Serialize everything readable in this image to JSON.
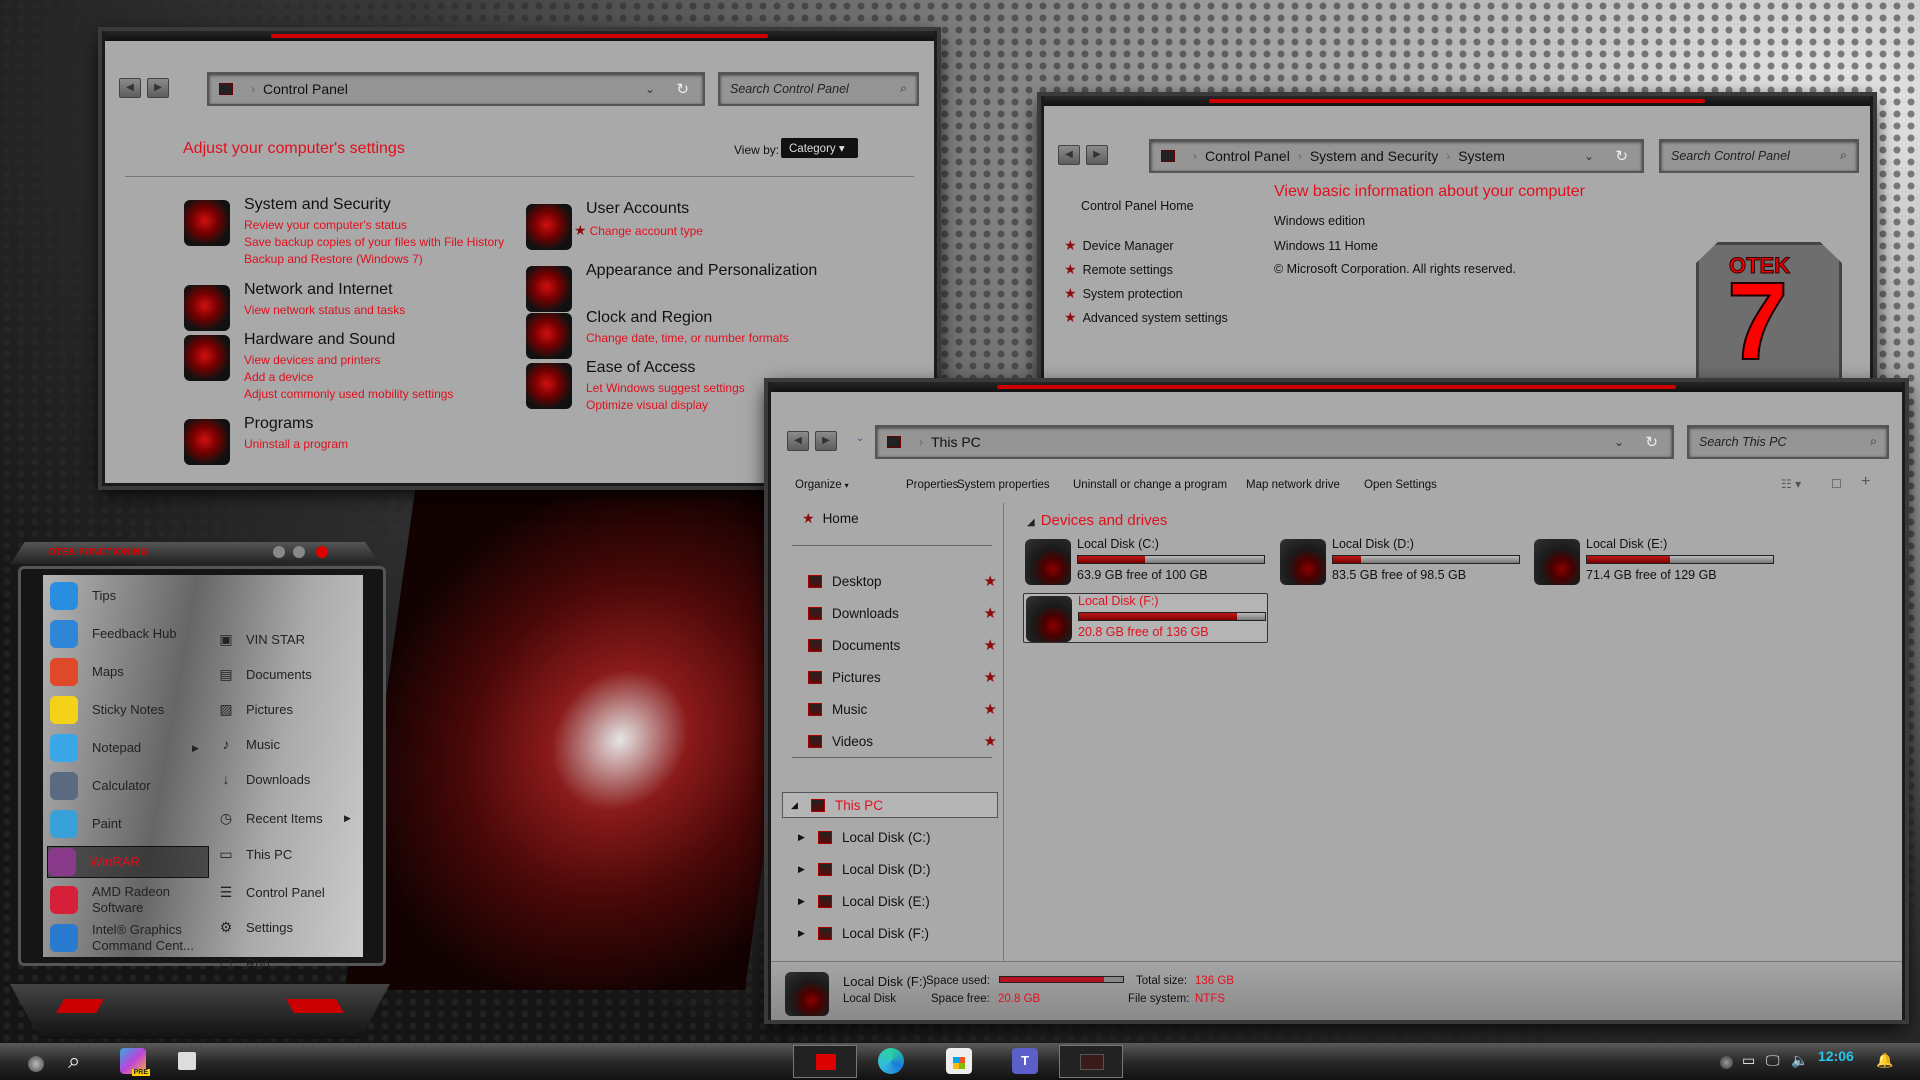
{
  "control_panel": {
    "address": [
      "Control Panel"
    ],
    "search_placeholder": "Search Control Panel",
    "heading": "Adjust your computer's settings",
    "view_by_label": "View by:",
    "view_by_value": "Category",
    "categories_left": [
      {
        "title": "System and Security",
        "links": [
          "Review your computer's status",
          "Save backup copies of your files with File History",
          "Backup and Restore (Windows 7)"
        ]
      },
      {
        "title": "Network and Internet",
        "links": [
          "View network status and tasks"
        ]
      },
      {
        "title": "Hardware and Sound",
        "links": [
          "View devices and printers",
          "Add a device",
          "Adjust commonly used mobility settings"
        ]
      },
      {
        "title": "Programs",
        "links": [
          "Uninstall a program"
        ]
      }
    ],
    "categories_right": [
      {
        "title": "User Accounts",
        "links": [
          "Change account type"
        ]
      },
      {
        "title": "Appearance and Personalization",
        "links": []
      },
      {
        "title": "Clock and Region",
        "links": [
          "Change date, time, or number formats"
        ]
      },
      {
        "title": "Ease of Access",
        "links": [
          "Let Windows suggest settings",
          "Optimize visual display"
        ]
      }
    ]
  },
  "system": {
    "address": [
      "Control Panel",
      "System and Security",
      "System"
    ],
    "search_placeholder": "Search Control Panel",
    "home": "Control Panel Home",
    "tasks": [
      "Device Manager",
      "Remote settings",
      "System protection",
      "Advanced system settings"
    ],
    "heading": "View basic information about your computer",
    "edition_label": "Windows edition",
    "edition": "Windows 11 Home",
    "copyright": "© Microsoft Corporation. All rights reserved.",
    "logo_text": "OTEK 7"
  },
  "this_pc": {
    "address": [
      "This PC"
    ],
    "search_placeholder": "Search This PC",
    "commands": [
      "Organize",
      "Properties",
      "System properties",
      "Uninstall or change a program",
      "Map network drive",
      "Open Settings"
    ],
    "nav_home": "Home",
    "quick_access": [
      "Desktop",
      "Downloads",
      "Documents",
      "Pictures",
      "Music",
      "Videos"
    ],
    "nav_this_pc": "This PC",
    "nav_drives": [
      "Local Disk (C:)",
      "Local Disk (D:)",
      "Local Disk (E:)",
      "Local Disk (F:)"
    ],
    "group_title": "Devices and drives",
    "drives": [
      {
        "name": "Local Disk (C:)",
        "status": "63.9 GB free of 100 GB",
        "used_fraction": 0.361
      },
      {
        "name": "Local Disk (D:)",
        "status": "83.5 GB free of 98.5 GB",
        "used_fraction": 0.152
      },
      {
        "name": "Local Disk (E:)",
        "status": "71.4 GB free of 129 GB",
        "used_fraction": 0.447
      },
      {
        "name": "Local Disk (F:)",
        "status": "20.8 GB free of 136 GB",
        "used_fraction": 0.847,
        "selected": true
      }
    ],
    "details": {
      "name": "Local Disk (F:)",
      "type": "Local Disk",
      "space_used_label": "Space used:",
      "space_free_label": "Space free:",
      "space_free": "20.8 GB",
      "total_label": "Total size:",
      "total": "136 GB",
      "fs_label": "File system:",
      "fs": "NTFS",
      "used_fraction": 0.847
    }
  },
  "start_menu": {
    "title": "OTEK FUNCTIONING",
    "apps": [
      {
        "label": "Tips",
        "color": "#2a8ee0"
      },
      {
        "label": "Feedback Hub",
        "color": "#2f86d6"
      },
      {
        "label": "Maps",
        "color": "#e0482a"
      },
      {
        "label": "Sticky Notes",
        "color": "#f5d21a"
      },
      {
        "label": "Notepad",
        "color": "#3aa8e8",
        "submenu": true
      },
      {
        "label": "Calculator",
        "color": "#5a6a80"
      },
      {
        "label": "Paint",
        "color": "#3aa0d8"
      },
      {
        "label": "WinRAR",
        "color": "#8a3a8a",
        "highlighted": true
      },
      {
        "label": "AMD Radeon Software",
        "color": "#d81f3a"
      },
      {
        "label": "Intel® Graphics Command Cent...",
        "color": "#2a7ad0"
      }
    ],
    "places": [
      {
        "label": "VIN STAR",
        "icon": "user-folder-icon",
        "glyph": "▣"
      },
      {
        "label": "Documents",
        "icon": "document-icon",
        "glyph": "▤"
      },
      {
        "label": "Pictures",
        "icon": "picture-icon",
        "glyph": "▨"
      },
      {
        "label": "Music",
        "icon": "music-icon",
        "glyph": "♪"
      },
      {
        "label": "Downloads",
        "icon": "download-icon",
        "glyph": "↓"
      },
      {
        "label": "Recent Items",
        "icon": "clock-icon",
        "glyph": "◷",
        "submenu": true
      },
      {
        "label": "This PC",
        "icon": "computer-icon",
        "glyph": "▭"
      },
      {
        "label": "Control Panel",
        "icon": "control-panel-icon",
        "glyph": "☰"
      },
      {
        "label": "Settings",
        "icon": "gear-icon",
        "glyph": "⚙"
      },
      {
        "label": "Run...",
        "icon": "run-icon",
        "glyph": "▢"
      }
    ]
  },
  "taskbar": {
    "clock": "12:06",
    "clock_color": "#29c5e6",
    "copilot_badge": "PRE",
    "teams_letter": "T"
  },
  "colors": {
    "accent": "#e0101e",
    "window_bg": "#a9a9a9"
  }
}
